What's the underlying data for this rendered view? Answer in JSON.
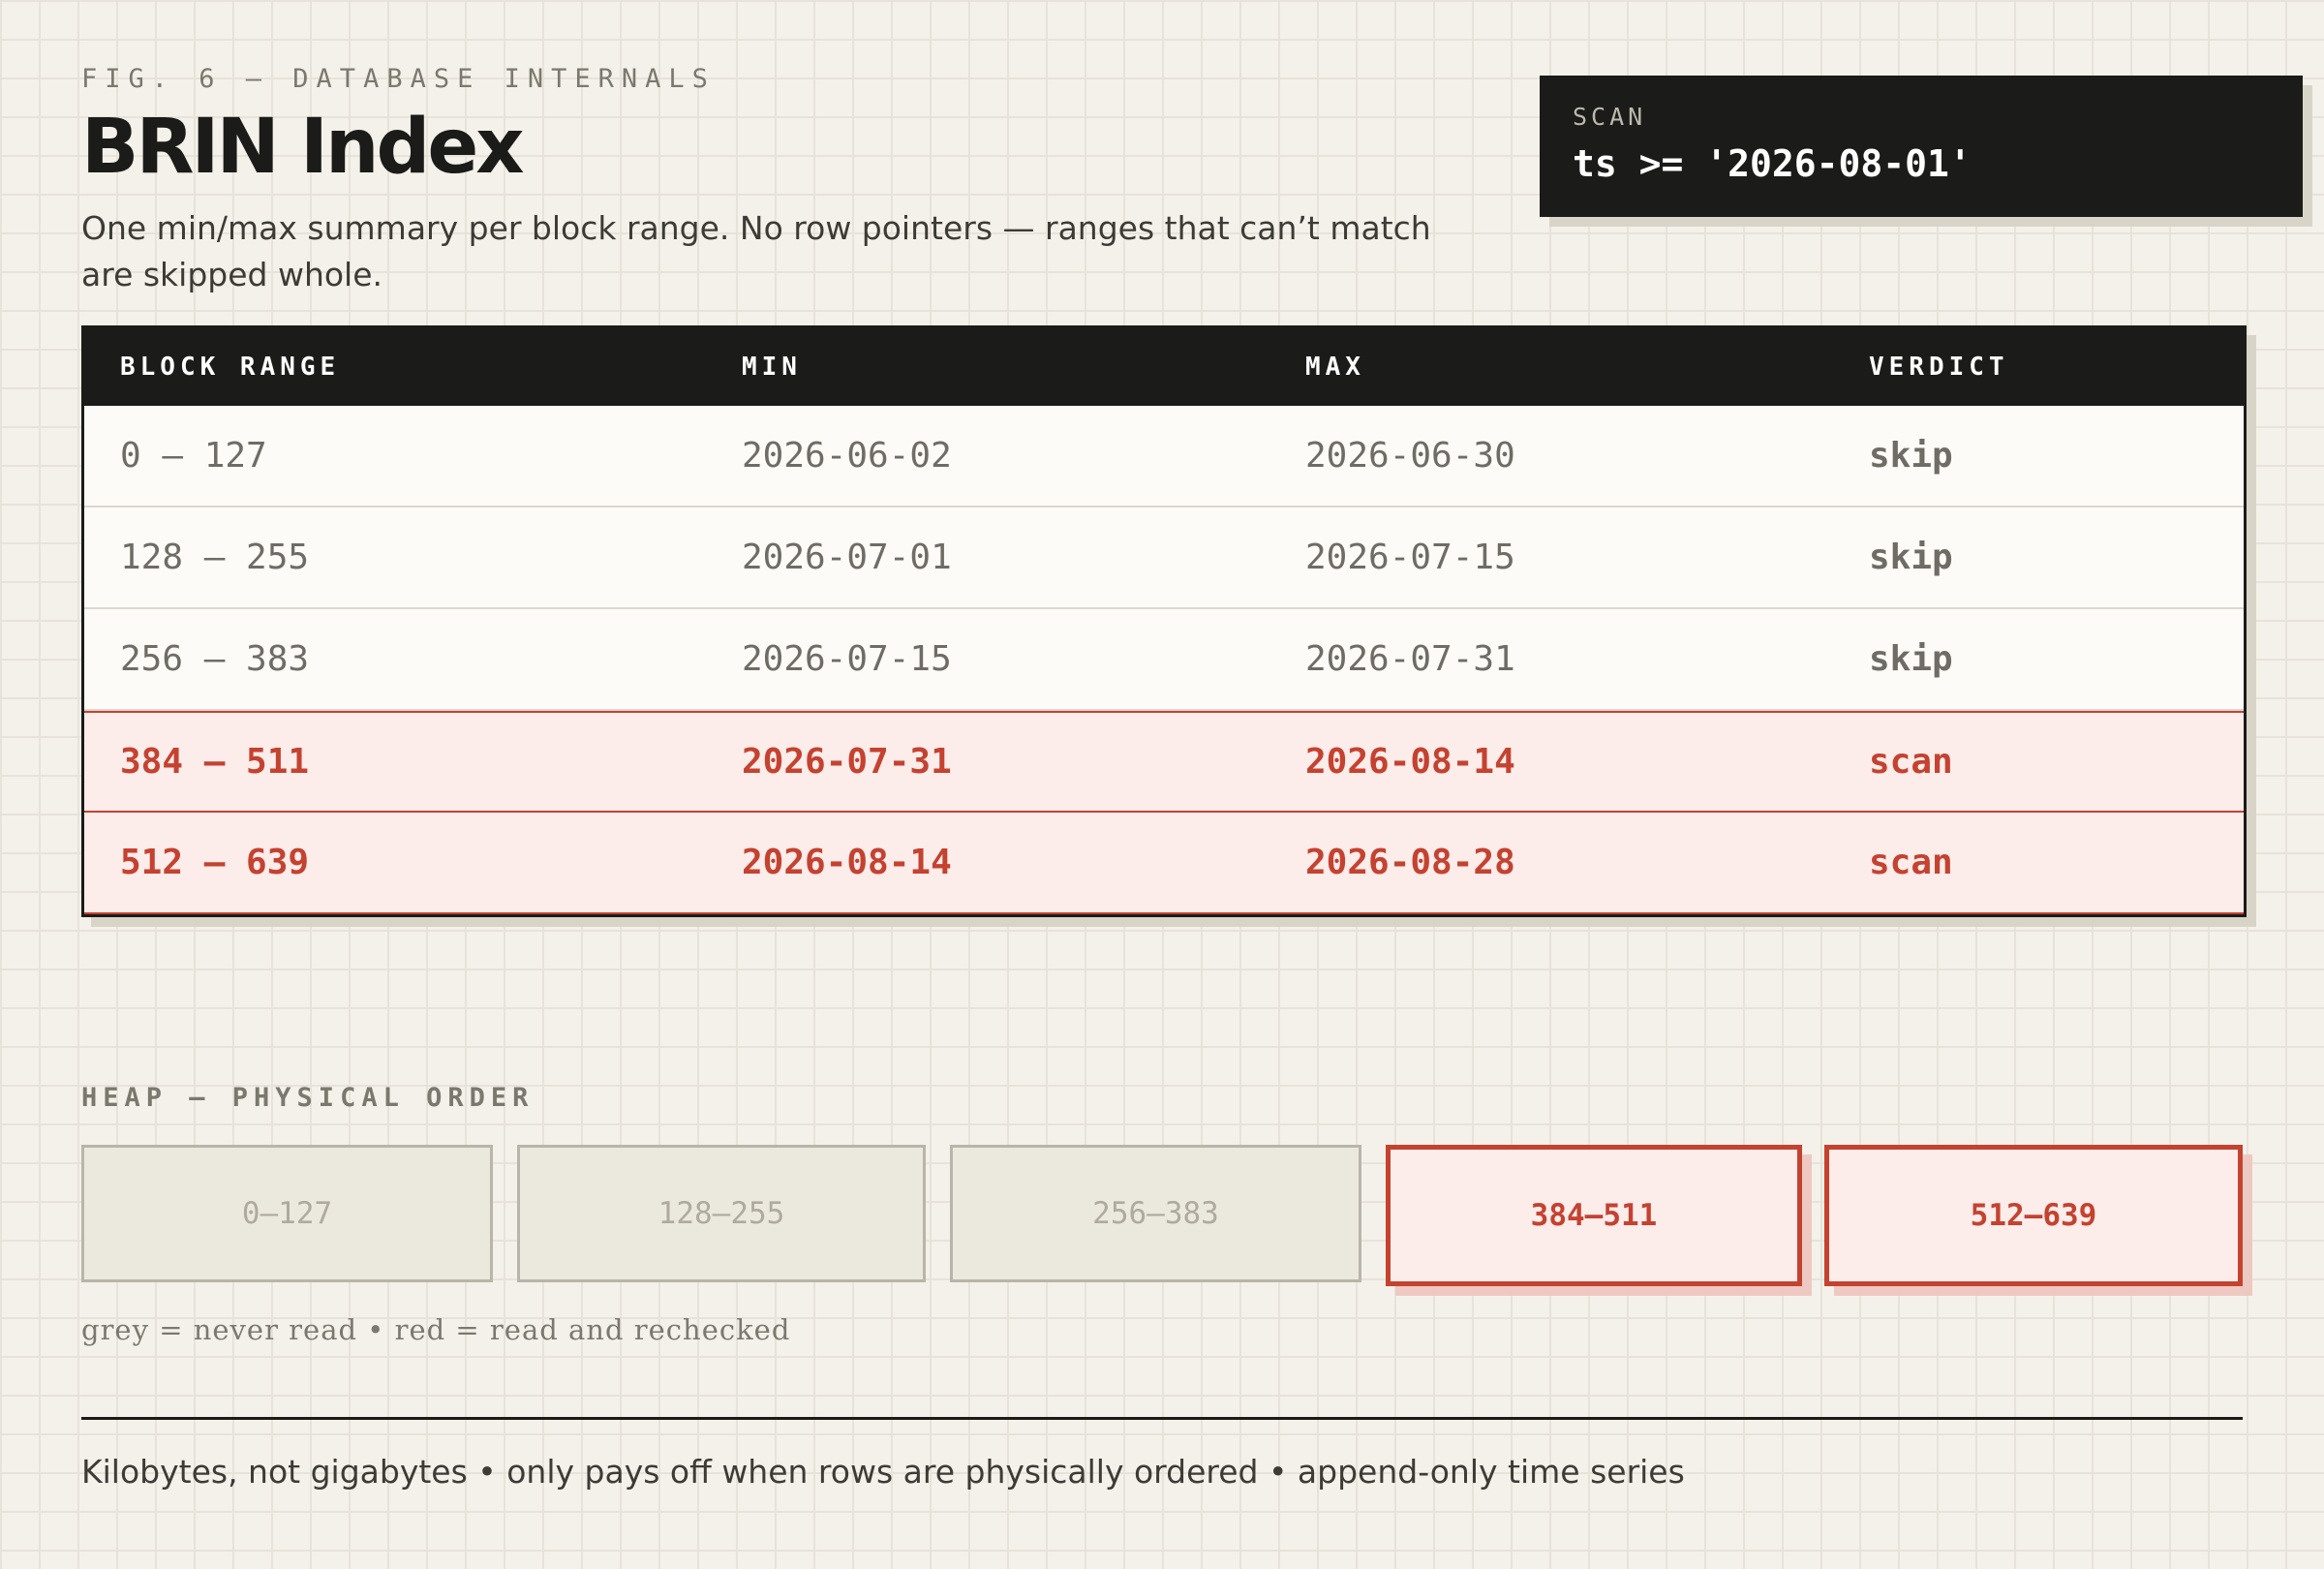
{
  "header": {
    "eyebrow": "FIG. 6 — DATABASE INTERNALS",
    "title": "BRIN Index",
    "subtitle": "One min/max summary per block range. No row pointers — ranges that can’t match are skipped whole."
  },
  "scan": {
    "label": "SCAN",
    "query": "ts >= '2026-08-01'"
  },
  "table": {
    "columns": [
      "BLOCK RANGE",
      "MIN",
      "MAX",
      "VERDICT"
    ],
    "rows": [
      {
        "range": "0 – 127",
        "min": "2026-06-02",
        "max": "2026-06-30",
        "verdict": "skip"
      },
      {
        "range": "128 – 255",
        "min": "2026-07-01",
        "max": "2026-07-15",
        "verdict": "skip"
      },
      {
        "range": "256 – 383",
        "min": "2026-07-15",
        "max": "2026-07-31",
        "verdict": "skip"
      },
      {
        "range": "384 – 511",
        "min": "2026-07-31",
        "max": "2026-08-14",
        "verdict": "scan"
      },
      {
        "range": "512 – 639",
        "min": "2026-08-14",
        "max": "2026-08-28",
        "verdict": "scan"
      }
    ]
  },
  "heap": {
    "label": "HEAP — PHYSICAL ORDER",
    "blocks": [
      {
        "label": "0–127",
        "state": "never-read"
      },
      {
        "label": "128–255",
        "state": "never-read"
      },
      {
        "label": "256–383",
        "state": "never-read"
      },
      {
        "label": "384–511",
        "state": "read"
      },
      {
        "label": "512–639",
        "state": "read"
      }
    ],
    "legend": "grey = never read • red = read and rechecked"
  },
  "colors": {
    "accent_red": "#c44230",
    "ink": "#1b1b19",
    "paper": "#f4f1ea",
    "muted": "#7b786e"
  },
  "footer": "Kilobytes, not gigabytes • only pays off when rows are physically ordered • append-only time series"
}
